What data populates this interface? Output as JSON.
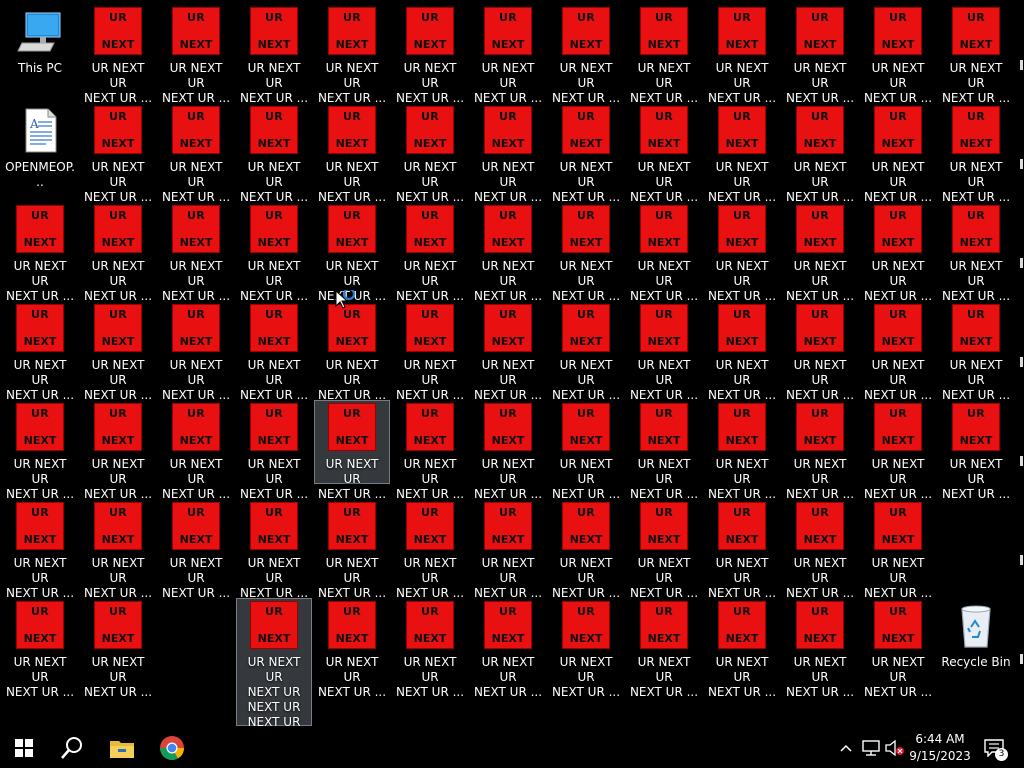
{
  "desktop": {
    "this_pc_label": "This PC",
    "doc_label": "OPENMEOP...",
    "recycle_label": "Recycle Bin",
    "icon_text_top": "UR",
    "icon_text_bottom": "NEXT",
    "caption_short": "UR NEXT UR\nNEXT UR ...",
    "caption_expanded": "UR NEXT UR\nNEXT UR\nNEXT UR\nNEXT UR\nNEXT UR"
  },
  "taskbar": {
    "time": "6:44 AM",
    "date": "9/15/2023",
    "notification_count": "3"
  },
  "icons": {
    "start": "windows-start-icon",
    "search": "search-icon",
    "explorer": "file-explorer-icon",
    "chrome": "chrome-icon",
    "tray_chevron": "chevron-up-icon",
    "network": "network-icon",
    "volume": "volume-muted-icon",
    "notifications": "notification-icon"
  },
  "colors": {
    "desktop_bg": "#000000",
    "file_red": "#e81010",
    "selection": "#8c96a0"
  }
}
